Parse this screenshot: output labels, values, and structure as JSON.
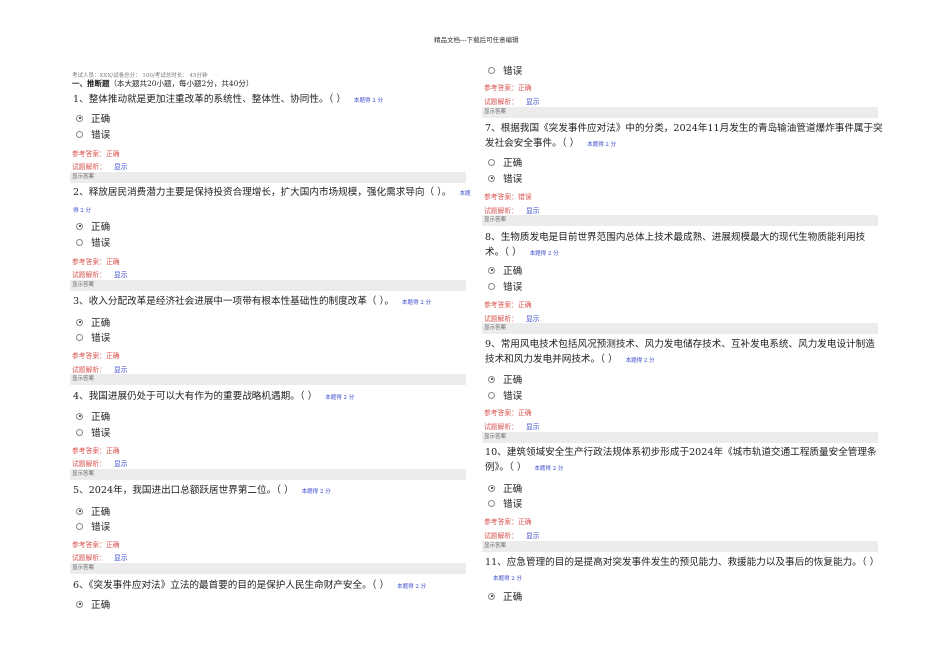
{
  "header": {
    "watermark": "精品文档---下载后可任意编辑"
  },
  "exam_meta": "考试人员：XXX/试卷总分： 100/考试总时长： 45分钟",
  "section": {
    "title": "一、推断题",
    "desc": "（本大题共20小题，每小题2分，共40分）"
  },
  "labels": {
    "score": "本题得 2 分",
    "answer_prefix": "参考答案：",
    "analysis": "试题解析：",
    "show": "显示",
    "show_answer": "显示答案",
    "option_true": "正确",
    "option_false": "错误"
  },
  "questions": [
    {
      "text": "1、整体推动就是更加注重改革的系统性、整体性、协同性。（ ）",
      "selected": "正确",
      "answer": "正确"
    },
    {
      "text": "2、释放居民消费潜力主要是保持投资合理增长，扩大国内市场规模，强化需求导向（ ）。",
      "selected": "正确",
      "answer": "正确"
    },
    {
      "text": "3、收入分配改革是经济社会进展中一项带有根本性基础性的制度改革（ ）。",
      "selected": "正确",
      "answer": "正确"
    },
    {
      "text": "4、我国进展仍处于可以大有作为的重要战略机遇期。（ ）",
      "selected": "正确",
      "answer": "正确"
    },
    {
      "text": "5、2024年，我国进出口总额跃居世界第二位。（ ）",
      "selected": "正确",
      "answer": "正确"
    },
    {
      "text": "6、《突发事件应对法》立法的最首要的目的是保护人民生命财产安全。（ ）",
      "selected": "正确",
      "answer": "正确"
    },
    {
      "text": "7、根据我国《突发事件应对法》中的分类，2024年11月发生的青岛输油管道爆炸事件属于突发社会安全事件。（ ）",
      "selected": "错误",
      "answer": "错误"
    },
    {
      "text": "8、生物质发电是目前世界范围内总体上技术最成熟、进展规模最大的现代生物质能利用技术。（ ）",
      "selected": "正确",
      "answer": "正确"
    },
    {
      "text": "9、常用风电技术包括风况预测技术、风力发电储存技术、互补发电系统、风力发电设计制造技术和风力发电并网技术。（ ）",
      "selected": "正确",
      "answer": "正确"
    },
    {
      "text": "10、建筑领域安全生产行政法规体系初步形成于2024年《城市轨道交通工程质量安全管理条例》。（ ）",
      "selected": "正确",
      "answer": "正确"
    },
    {
      "text": "11、应急管理的目的是提高对突发事件发生的预见能力、救援能力以及事后的恢复能力。（ ）",
      "selected": "正确",
      "answer": ""
    }
  ]
}
